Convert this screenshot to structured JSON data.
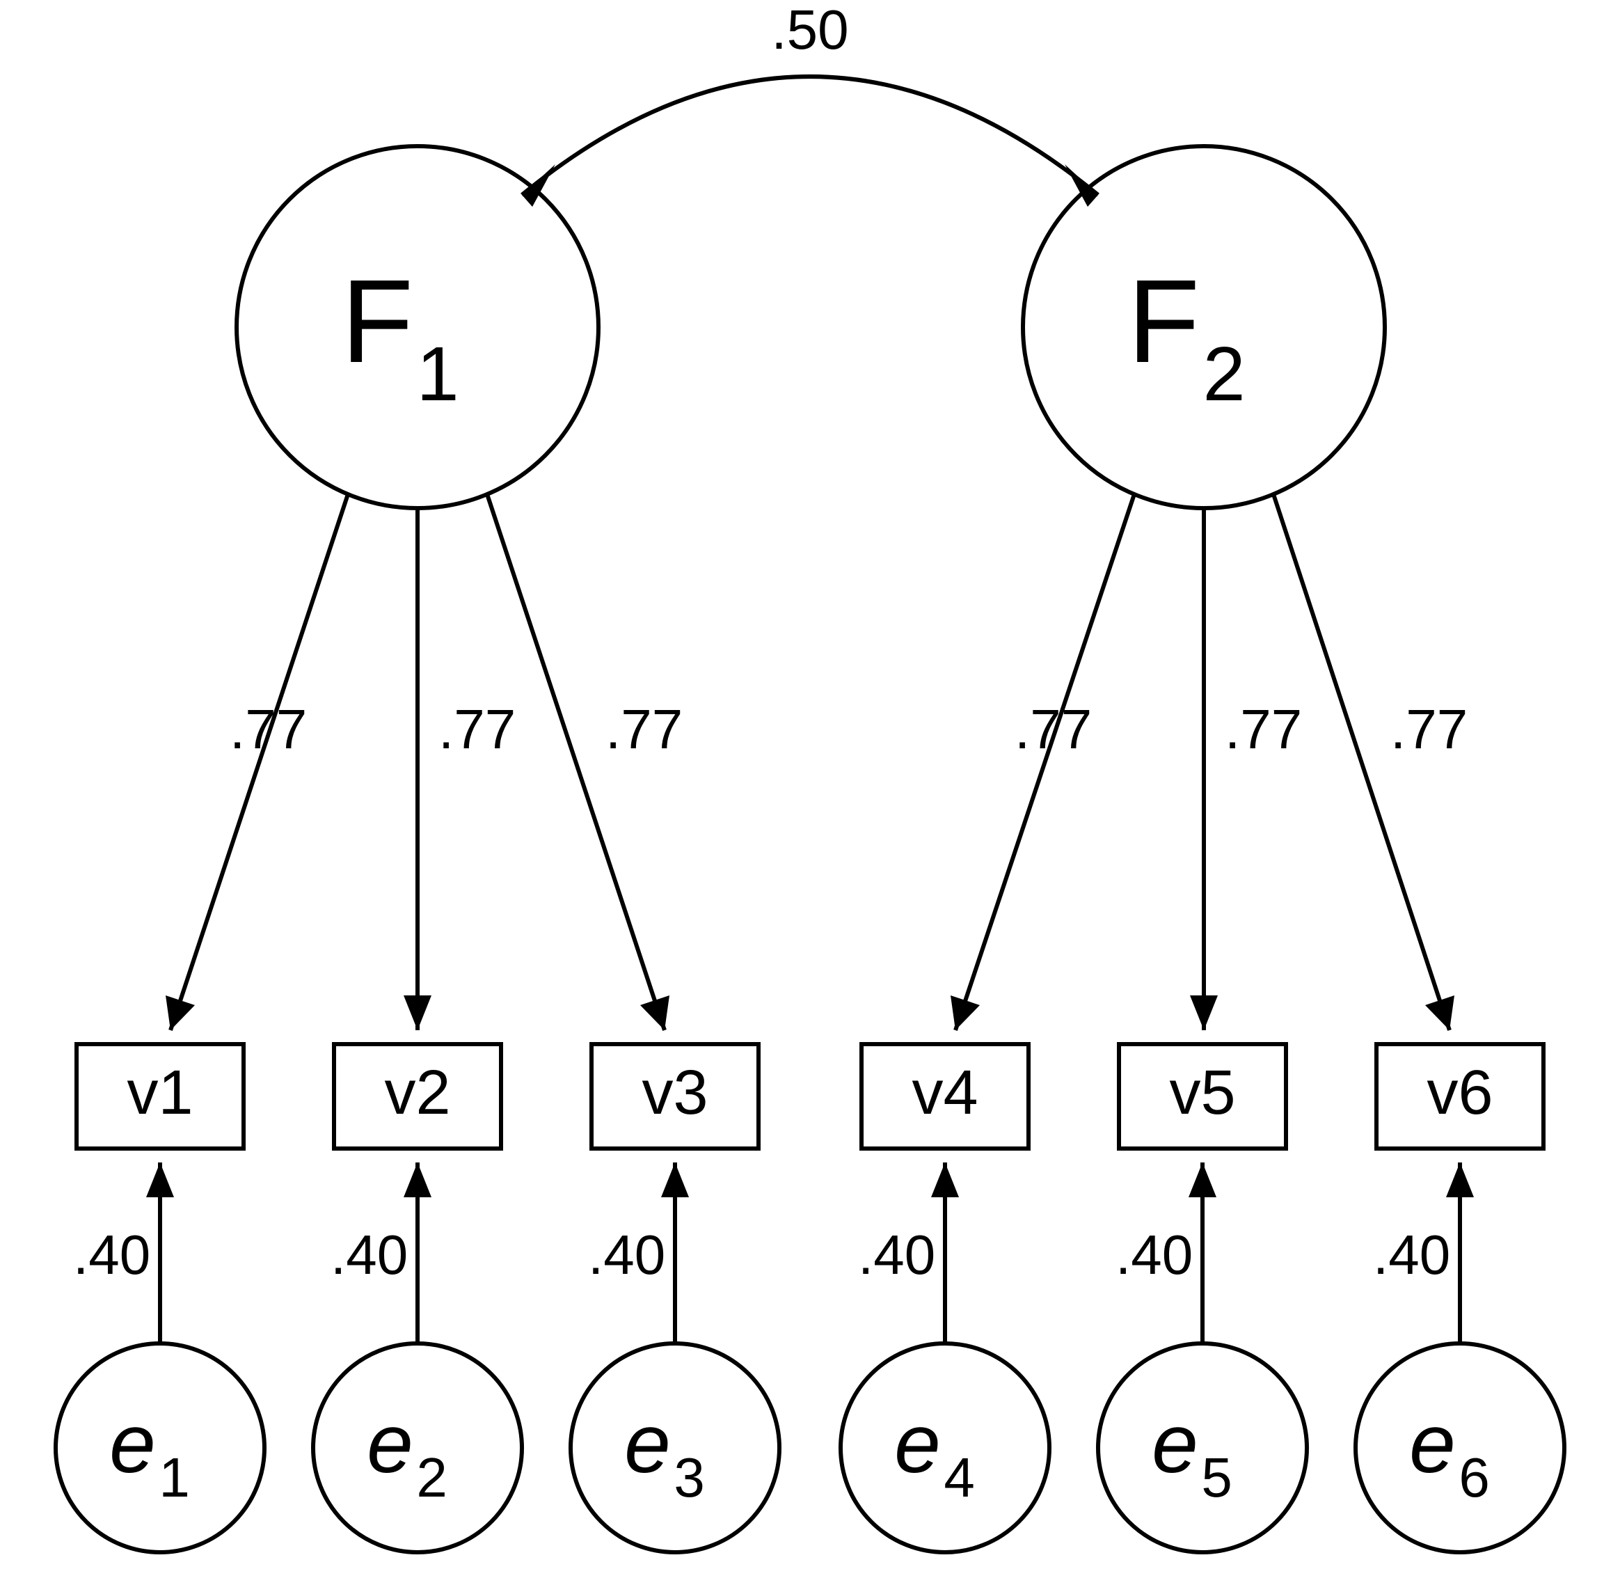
{
  "factors": [
    {
      "name": "F",
      "sub": "1"
    },
    {
      "name": "F",
      "sub": "2"
    }
  ],
  "correlation": ".50",
  "loadings": {
    "f1": [
      ".77",
      ".77",
      ".77"
    ],
    "f2": [
      ".77",
      ".77",
      ".77"
    ]
  },
  "observed": [
    "v1",
    "v2",
    "v3",
    "v4",
    "v5",
    "v6"
  ],
  "errors": [
    {
      "name": "e",
      "sub": "1",
      "coef": ".40"
    },
    {
      "name": "e",
      "sub": "2",
      "coef": ".40"
    },
    {
      "name": "e",
      "sub": "3",
      "coef": ".40"
    },
    {
      "name": "e",
      "sub": "4",
      "coef": ".40"
    },
    {
      "name": "e",
      "sub": "5",
      "coef": ".40"
    },
    {
      "name": "e",
      "sub": "6",
      "coef": ".40"
    }
  ]
}
